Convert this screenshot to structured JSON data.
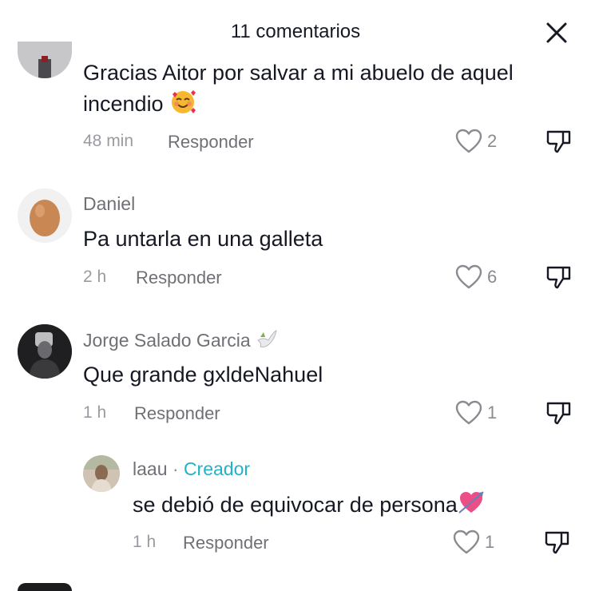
{
  "header": {
    "title": "11 comentarios"
  },
  "comments": [
    {
      "text": "Gracias Aitor por salvar a mi abuelo de aquel incendio",
      "text_line1": "Gracias Aitor por salvar a mi abuelo de aquel",
      "text_line2": "incendio",
      "emoji": "smiling-face-with-hearts-icon",
      "time": "48 min",
      "reply_label": "Responder",
      "likes": "2"
    },
    {
      "username": "Daniel",
      "text": "Pa untarla en una galleta",
      "time": "2 h",
      "reply_label": "Responder",
      "likes": "6"
    },
    {
      "username": "Jorge Salado Garcia",
      "username_emoji": "dove-icon",
      "text": "Que grande gxldeNahuel",
      "time": "1 h",
      "reply_label": "Responder",
      "likes": "1"
    },
    {
      "username": "laau",
      "separator": "·",
      "badge": "Creador",
      "text": "se debió de equivocar de persona",
      "emoji": "heart-with-arrow-icon",
      "time": "1 h",
      "reply_label": "Responder",
      "likes": "1"
    }
  ],
  "colors": {
    "creator": "#20b3c8",
    "text": "#161823",
    "muted": "#8a8b91"
  }
}
